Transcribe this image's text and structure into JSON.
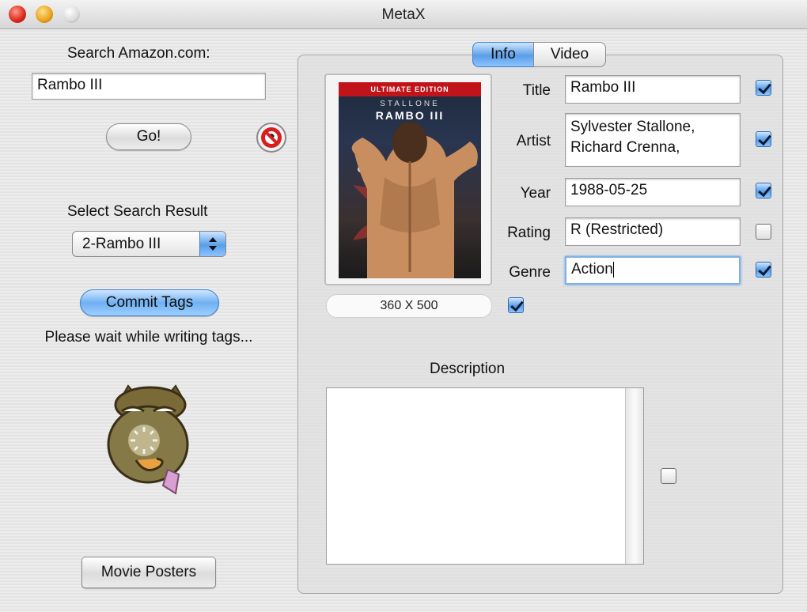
{
  "window": {
    "title": "MetaX"
  },
  "search": {
    "label": "Search Amazon.com:",
    "query": "Rambo III",
    "go_label": "Go!",
    "result_label": "Select Search Result",
    "result_value": "2-Rambo III"
  },
  "actions": {
    "commit_label": "Commit Tags",
    "status": "Please wait while writing tags...",
    "posters_label": "Movie Posters"
  },
  "tabs": [
    {
      "label": "Info",
      "selected": true
    },
    {
      "label": "Video",
      "selected": false
    }
  ],
  "poster": {
    "edition": "ULTIMATE EDITION",
    "actor": "STALLONE",
    "movie": "RAMBO III",
    "size": "360 X 500",
    "size_checked": true
  },
  "fields": {
    "title": {
      "label": "Title",
      "value": "Rambo III",
      "checked": true
    },
    "artist": {
      "label": "Artist",
      "line1": "Sylvester Stallone,",
      "line2": "Richard Crenna,",
      "checked": true
    },
    "year": {
      "label": "Year",
      "value": "1988-05-25",
      "checked": true
    },
    "rating": {
      "label": "Rating",
      "value": "R (Restricted)",
      "checked": false
    },
    "genre": {
      "label": "Genre",
      "value": "Action",
      "checked": true
    }
  },
  "description": {
    "label": "Description",
    "value": "",
    "checked": false
  },
  "colors": {
    "accent": "#5a9ee8",
    "close": "#d8261a",
    "minimize": "#e8a11a"
  }
}
